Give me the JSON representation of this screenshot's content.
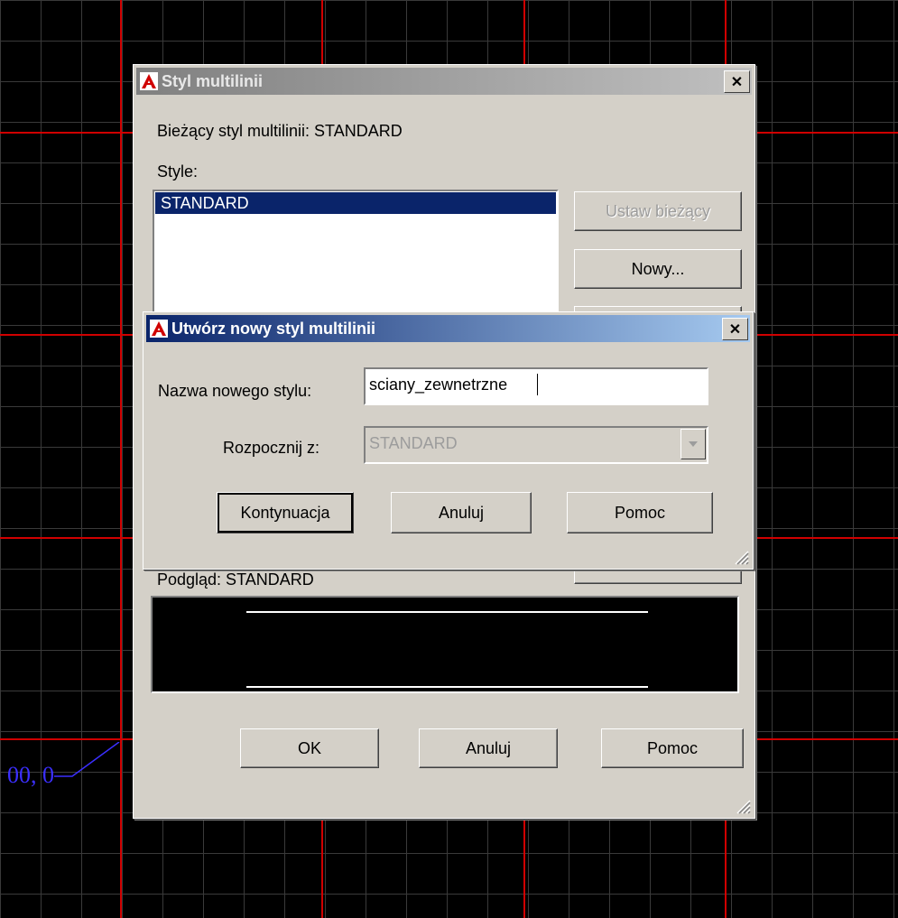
{
  "canvas": {
    "coordinate_text": "00, 0"
  },
  "outer_dialog": {
    "title": "Styl multilinii",
    "close_symbol": "✕",
    "current_style_label": "Bieżący styl multilinii: STANDARD",
    "styles_label": "Style:",
    "styles_list": [
      "STANDARD"
    ],
    "selected_style": "STANDARD",
    "set_current_button": "Ustaw bieżący",
    "new_button": "Nowy...",
    "preview_label": "Podgląd: STANDARD",
    "ok_button": "OK",
    "cancel_button": "Anuluj",
    "help_button": "Pomoc"
  },
  "inner_dialog": {
    "title": "Utwórz nowy styl multilinii",
    "close_symbol": "✕",
    "name_label": "Nazwa nowego stylu:",
    "name_value": "sciany_zewnetrzne",
    "start_with_label": "Rozpocznij z:",
    "start_with_value": "STANDARD",
    "continue_button": "Kontynuacja",
    "cancel_button": "Anuluj",
    "help_button": "Pomoc"
  },
  "colors": {
    "title_active_start": "#0a246a",
    "title_active_end": "#a6caf0",
    "title_inactive_start": "#808080",
    "title_inactive_end": "#c0c0c0",
    "grid_axis": "#d00000",
    "selection": "#0a246a",
    "dialog_face": "#d4d0c8"
  }
}
